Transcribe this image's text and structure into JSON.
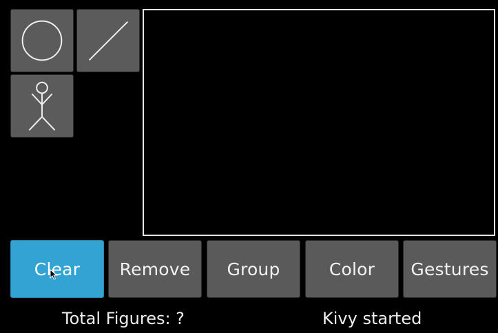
{
  "tools": [
    {
      "name": "circle",
      "icon": "circle-icon"
    },
    {
      "name": "line",
      "icon": "line-icon"
    },
    {
      "name": "stickman",
      "icon": "stickman-icon"
    }
  ],
  "actions": [
    {
      "label": "Clear",
      "active": true
    },
    {
      "label": "Remove",
      "active": false
    },
    {
      "label": "Group",
      "active": false
    },
    {
      "label": "Color",
      "active": false
    },
    {
      "label": "Gestures",
      "active": false
    }
  ],
  "status": {
    "figures": "Total Figures: ?",
    "message": "Kivy started"
  },
  "colors": {
    "background": "#000000",
    "button": "#5a5a5a",
    "active_button": "#33a3d3",
    "canvas_border": "#e6e6e6"
  }
}
